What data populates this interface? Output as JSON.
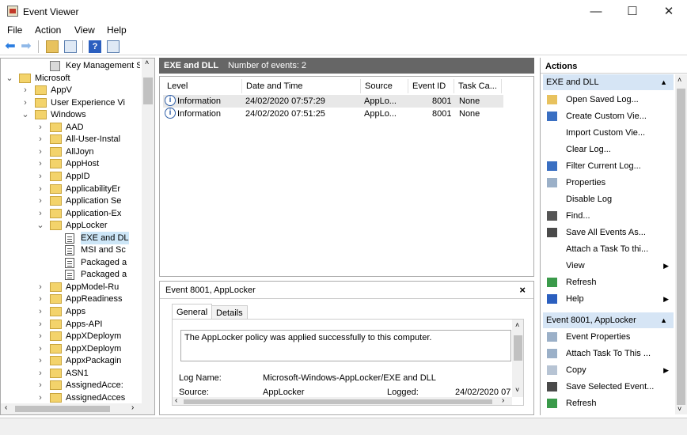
{
  "window": {
    "title": "Event Viewer",
    "minimize": "—",
    "maximize": "☐",
    "close": "✕"
  },
  "menu": [
    "File",
    "Action",
    "View",
    "Help"
  ],
  "tree": {
    "items": [
      {
        "label": "Key Management Ser",
        "level": 3,
        "expander": "",
        "icon": "log-key"
      },
      {
        "label": "Microsoft",
        "level": 1,
        "expander": "⌄",
        "icon": "folder"
      },
      {
        "label": "AppV",
        "level": 2,
        "expander": "›",
        "icon": "folder"
      },
      {
        "label": "User Experience Vi",
        "level": 2,
        "expander": "›",
        "icon": "folder"
      },
      {
        "label": "Windows",
        "level": 2,
        "expander": "⌄",
        "icon": "folder"
      },
      {
        "label": "AAD",
        "level": 3,
        "expander": "›",
        "icon": "folder"
      },
      {
        "label": "All-User-Instal",
        "level": 3,
        "expander": "›",
        "icon": "folder"
      },
      {
        "label": "AllJoyn",
        "level": 3,
        "expander": "›",
        "icon": "folder"
      },
      {
        "label": "AppHost",
        "level": 3,
        "expander": "›",
        "icon": "folder"
      },
      {
        "label": "AppID",
        "level": 3,
        "expander": "›",
        "icon": "folder"
      },
      {
        "label": "ApplicabilityEr",
        "level": 3,
        "expander": "›",
        "icon": "folder"
      },
      {
        "label": "Application Se",
        "level": 3,
        "expander": "›",
        "icon": "folder"
      },
      {
        "label": "Application-Ex",
        "level": 3,
        "expander": "›",
        "icon": "folder"
      },
      {
        "label": "AppLocker",
        "level": 3,
        "expander": "⌄",
        "icon": "folder"
      },
      {
        "label": "EXE and DL",
        "level": 4,
        "expander": "",
        "icon": "log",
        "selected": true
      },
      {
        "label": "MSI and Sc",
        "level": 4,
        "expander": "",
        "icon": "log"
      },
      {
        "label": "Packaged a",
        "level": 4,
        "expander": "",
        "icon": "log"
      },
      {
        "label": "Packaged a",
        "level": 4,
        "expander": "",
        "icon": "log"
      },
      {
        "label": "AppModel-Ru",
        "level": 3,
        "expander": "›",
        "icon": "folder"
      },
      {
        "label": "AppReadiness",
        "level": 3,
        "expander": "›",
        "icon": "folder"
      },
      {
        "label": "Apps",
        "level": 3,
        "expander": "›",
        "icon": "folder"
      },
      {
        "label": "Apps-API",
        "level": 3,
        "expander": "›",
        "icon": "folder"
      },
      {
        "label": "AppXDeploym",
        "level": 3,
        "expander": "›",
        "icon": "folder"
      },
      {
        "label": "AppXDeploym",
        "level": 3,
        "expander": "›",
        "icon": "folder"
      },
      {
        "label": "AppxPackagin",
        "level": 3,
        "expander": "›",
        "icon": "folder"
      },
      {
        "label": "ASN1",
        "level": 3,
        "expander": "›",
        "icon": "folder"
      },
      {
        "label": "AssignedAcce:",
        "level": 3,
        "expander": "›",
        "icon": "folder"
      },
      {
        "label": "AssignedAcces",
        "level": 3,
        "expander": "›",
        "icon": "folder"
      }
    ]
  },
  "events": {
    "log_name": "EXE and DLL",
    "count_label": "Number of events: 2",
    "columns": [
      "Level",
      "Date and Time",
      "Source",
      "Event ID",
      "Task Ca..."
    ],
    "rows": [
      {
        "level": "Information",
        "datetime": "24/02/2020 07:57:29",
        "source": "AppLo...",
        "id": "8001",
        "task": "None"
      },
      {
        "level": "Information",
        "datetime": "24/02/2020 07:51:25",
        "source": "AppLo...",
        "id": "8001",
        "task": "None"
      }
    ]
  },
  "detail": {
    "title": "Event 8001, AppLocker",
    "close": "×",
    "tabs": [
      "General",
      "Details"
    ],
    "message": "The AppLocker policy was applied successfully to this computer.",
    "log_name_label": "Log Name:",
    "log_name_value": "Microsoft-Windows-AppLocker/EXE and DLL",
    "source_label": "Source:",
    "source_value": "AppLocker",
    "logged_label": "Logged:",
    "logged_value": "24/02/2020 07"
  },
  "actions": {
    "header": "Actions",
    "section1": "EXE and DLL",
    "items1": [
      {
        "label": "Open Saved Log...",
        "icon": "open-folder-icon"
      },
      {
        "label": "Create Custom Vie...",
        "icon": "filter-icon"
      },
      {
        "label": "Import Custom Vie...",
        "icon": ""
      },
      {
        "label": "Clear Log...",
        "icon": ""
      },
      {
        "label": "Filter Current Log...",
        "icon": "filter-icon"
      },
      {
        "label": "Properties",
        "icon": "properties-icon"
      },
      {
        "label": "Disable Log",
        "icon": ""
      },
      {
        "label": "Find...",
        "icon": "binoculars-icon"
      },
      {
        "label": "Save All Events As...",
        "icon": "save-icon"
      },
      {
        "label": "Attach a Task To thi...",
        "icon": ""
      },
      {
        "label": "View",
        "icon": "",
        "submenu": true
      },
      {
        "label": "Refresh",
        "icon": "refresh-icon"
      },
      {
        "label": "Help",
        "icon": "help-icon",
        "submenu": true
      }
    ],
    "section2": "Event 8001, AppLocker",
    "items2": [
      {
        "label": "Event Properties",
        "icon": "properties-icon"
      },
      {
        "label": "Attach Task To This ...",
        "icon": "task-icon"
      },
      {
        "label": "Copy",
        "icon": "copy-icon",
        "submenu": true
      },
      {
        "label": "Save Selected Event...",
        "icon": "save-icon"
      },
      {
        "label": "Refresh",
        "icon": "refresh-icon"
      }
    ]
  }
}
